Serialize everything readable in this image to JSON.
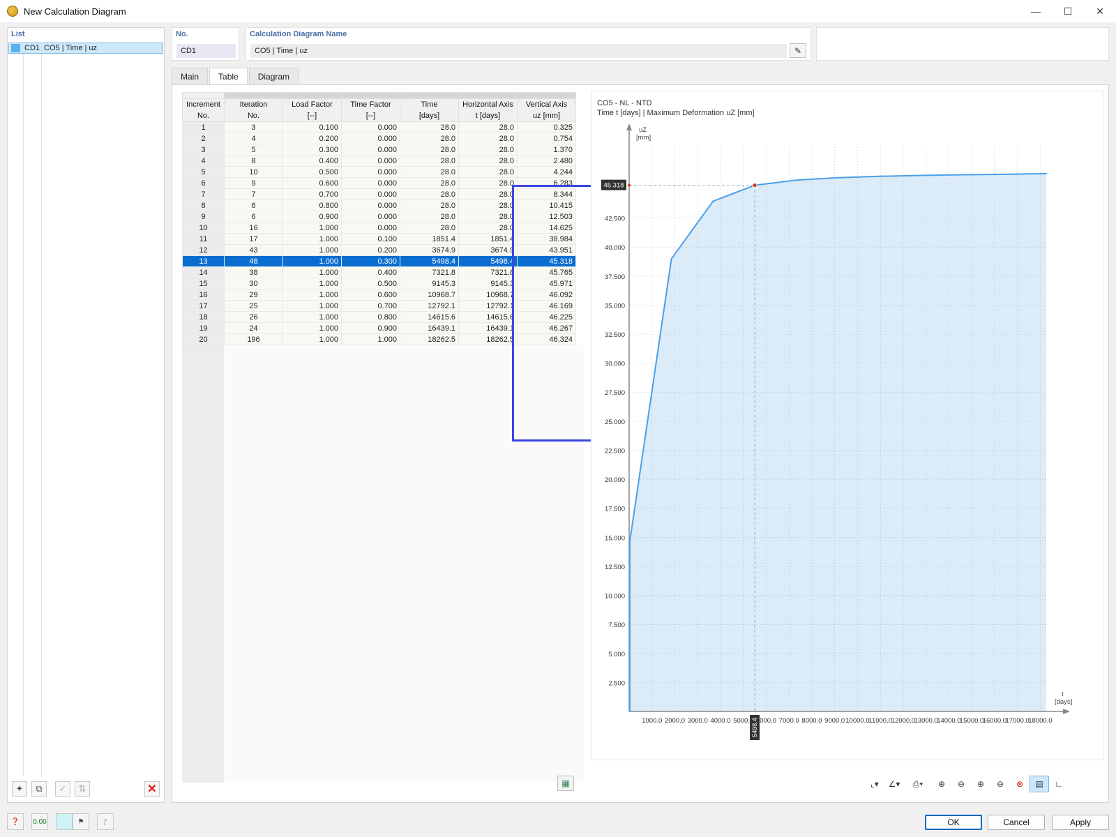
{
  "window": {
    "title": "New Calculation Diagram"
  },
  "list": {
    "label": "List",
    "items": [
      {
        "id": "CD1",
        "name": "CO5 | Time | uz",
        "color": "#5bb0ee"
      }
    ]
  },
  "no": {
    "label": "No.",
    "value": "CD1"
  },
  "name": {
    "label": "Calculation Diagram Name",
    "value": "CO5 | Time | uz"
  },
  "tabs": [
    {
      "label": "Main",
      "active": false
    },
    {
      "label": "Table",
      "active": true
    },
    {
      "label": "Diagram",
      "active": false
    }
  ],
  "table": {
    "headers": [
      [
        "Increment",
        "No."
      ],
      [
        "Iteration",
        "No."
      ],
      [
        "Load Factor",
        "[--]"
      ],
      [
        "Time Factor",
        "[--]"
      ],
      [
        "Time",
        "[days]"
      ],
      [
        "Horizontal Axis",
        "t [days]"
      ],
      [
        "Vertical Axis",
        "uz [mm]"
      ]
    ],
    "selected_row": 13,
    "rows": [
      [
        "1",
        "3",
        "0.100",
        "0.000",
        "28.0",
        "28.0",
        "0.325"
      ],
      [
        "2",
        "4",
        "0.200",
        "0.000",
        "28.0",
        "28.0",
        "0.754"
      ],
      [
        "3",
        "5",
        "0.300",
        "0.000",
        "28.0",
        "28.0",
        "1.370"
      ],
      [
        "4",
        "8",
        "0.400",
        "0.000",
        "28.0",
        "28.0",
        "2.480"
      ],
      [
        "5",
        "10",
        "0.500",
        "0.000",
        "28.0",
        "28.0",
        "4.244"
      ],
      [
        "6",
        "9",
        "0.600",
        "0.000",
        "28.0",
        "28.0",
        "6.283"
      ],
      [
        "7",
        "7",
        "0.700",
        "0.000",
        "28.0",
        "28.0",
        "8.344"
      ],
      [
        "8",
        "6",
        "0.800",
        "0.000",
        "28.0",
        "28.0",
        "10.415"
      ],
      [
        "9",
        "6",
        "0.900",
        "0.000",
        "28.0",
        "28.0",
        "12.503"
      ],
      [
        "10",
        "16",
        "1.000",
        "0.000",
        "28.0",
        "28.0",
        "14.625"
      ],
      [
        "11",
        "17",
        "1.000",
        "0.100",
        "1851.4",
        "1851.4",
        "38.984"
      ],
      [
        "12",
        "43",
        "1.000",
        "0.200",
        "3674.9",
        "3674.9",
        "43.951"
      ],
      [
        "13",
        "48",
        "1.000",
        "0.300",
        "5498.4",
        "5498.4",
        "45.318"
      ],
      [
        "14",
        "38",
        "1.000",
        "0.400",
        "7321.8",
        "7321.8",
        "45.765"
      ],
      [
        "15",
        "30",
        "1.000",
        "0.500",
        "9145.3",
        "9145.3",
        "45.971"
      ],
      [
        "16",
        "29",
        "1.000",
        "0.600",
        "10968.7",
        "10968.7",
        "46.092"
      ],
      [
        "17",
        "25",
        "1.000",
        "0.700",
        "12792.1",
        "12792.1",
        "46.169"
      ],
      [
        "18",
        "26",
        "1.000",
        "0.800",
        "14615.6",
        "14615.6",
        "46.225"
      ],
      [
        "19",
        "24",
        "1.000",
        "0.900",
        "16439.1",
        "16439.1",
        "46.267"
      ],
      [
        "20",
        "196",
        "1.000",
        "1.000",
        "18262.5",
        "18262.5",
        "46.324"
      ]
    ]
  },
  "chart_data": {
    "type": "area",
    "title": "CO5 - NL - NTD",
    "subtitle": "Time t [days] | Maximum Deformation uZ [mm]",
    "ylabel": "uZ",
    "yunit": "[mm]",
    "xlabel": "t",
    "xunit": "[days]",
    "ylim": [
      0,
      48
    ],
    "xlim": [
      0,
      18262.5
    ],
    "yticks": [
      "2.500",
      "5.000",
      "7.500",
      "10.000",
      "12.500",
      "15.000",
      "17.500",
      "20.000",
      "22.500",
      "25.000",
      "27.500",
      "30.000",
      "32.500",
      "35.000",
      "37.500",
      "40.000",
      "42.500"
    ],
    "xticks": [
      "1000.0",
      "2000.0",
      "3000.0",
      "4000.0",
      "5000.0",
      "6000.0",
      "7000.0",
      "8000.0",
      "9000.0",
      "10000.0",
      "11000.0",
      "12000.0",
      "13000.0",
      "14000.0",
      "15000.0",
      "16000.0",
      "17000.0",
      "18000.0"
    ],
    "x": [
      28.0,
      28.0,
      1851.4,
      3674.9,
      5498.4,
      7321.8,
      9145.3,
      10968.7,
      12792.1,
      14615.6,
      16439.1,
      18262.5
    ],
    "y": [
      0.0,
      14.625,
      38.984,
      43.951,
      45.318,
      45.765,
      45.971,
      46.092,
      46.169,
      46.225,
      46.267,
      46.324
    ],
    "marker": {
      "x": 5498.4,
      "y": 45.318,
      "xlabel": "5498.4",
      "ylabel": "45.318"
    },
    "line_color": "#4a9fe8",
    "fill_color": "#dcebf8",
    "grid": true
  },
  "dialog": {
    "ok": "OK",
    "cancel": "Cancel",
    "apply": "Apply"
  }
}
